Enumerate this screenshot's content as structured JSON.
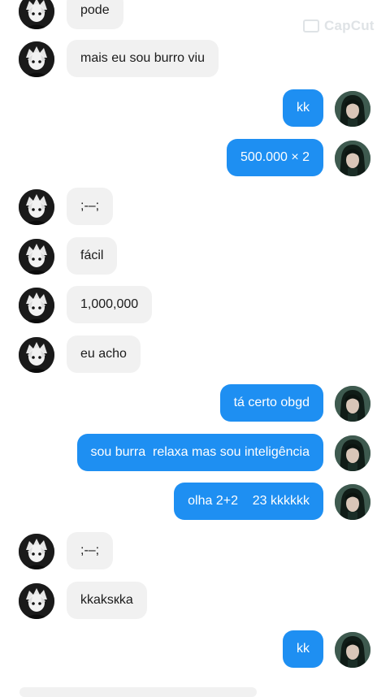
{
  "watermark": "CapCut",
  "messages": [
    {
      "side": "in",
      "text": "pode"
    },
    {
      "side": "in",
      "text": "mais eu sou burro viu"
    },
    {
      "side": "out",
      "text": "kk"
    },
    {
      "side": "out",
      "text": "500.000 × 2"
    },
    {
      "side": "in",
      "text": ";-–;"
    },
    {
      "side": "in",
      "text": "fácil"
    },
    {
      "side": "in",
      "text": "1,000,000"
    },
    {
      "side": "in",
      "text": "eu acho"
    },
    {
      "side": "out",
      "text": "tá certo obgd"
    },
    {
      "side": "out",
      "text": "sou burra  relaxa mas sou inteligência"
    },
    {
      "side": "out",
      "text": "olha 2+2    23 kkkkkk"
    },
    {
      "side": "in",
      "text": ";-–;"
    },
    {
      "side": "in",
      "text": "kkaksкka"
    },
    {
      "side": "out",
      "text": "kk"
    }
  ],
  "colors": {
    "outgoing_bubble": "#1e8ff2",
    "incoming_bubble": "#f1f1f1",
    "background": "#ffffff"
  },
  "icons": {
    "incoming_avatar": "anime-boy-avatar",
    "outgoing_avatar": "girl-photo-avatar"
  }
}
